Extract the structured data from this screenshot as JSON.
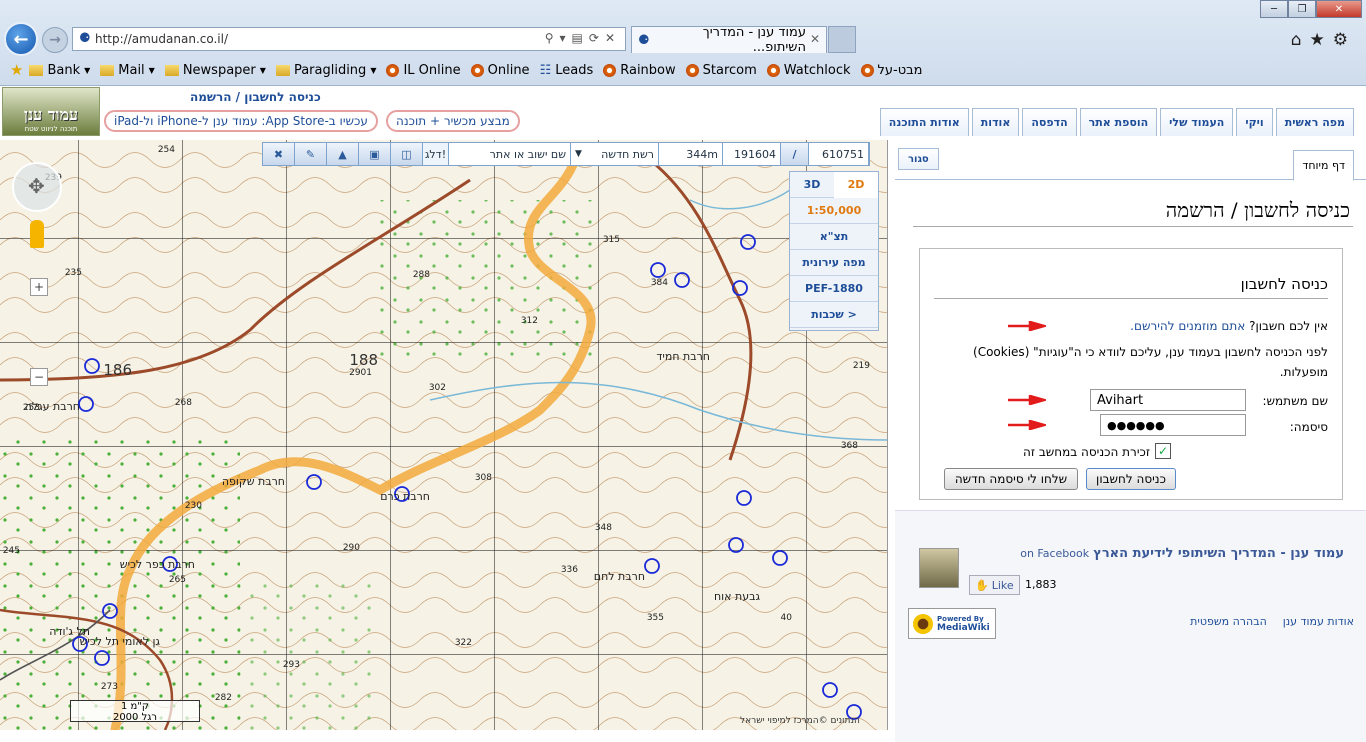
{
  "browser": {
    "url": "http://amudanan.co.il/",
    "tab_title": "עמוד ענן - המדריך השיתופ...",
    "window_controls": [
      "minimize",
      "restore",
      "close"
    ],
    "favorites": [
      {
        "label": "Bank",
        "icon": "folder-icon",
        "dropdown": true
      },
      {
        "label": "Mail",
        "icon": "folder-icon",
        "dropdown": true
      },
      {
        "label": "Newspaper",
        "icon": "folder-icon",
        "dropdown": true
      },
      {
        "label": "Paragliding",
        "icon": "folder-icon",
        "dropdown": true
      },
      {
        "label": "IL Online",
        "icon": "site-icon"
      },
      {
        "label": "Online",
        "icon": "site-icon"
      },
      {
        "label": "Leads",
        "icon": "page-icon"
      },
      {
        "label": "Rainbow",
        "icon": "site-icon"
      },
      {
        "label": "Starcom",
        "icon": "site-icon"
      },
      {
        "label": "Watchlock",
        "icon": "site-icon"
      },
      {
        "label": "מבט-על",
        "icon": "site-icon"
      }
    ]
  },
  "site": {
    "logo": {
      "title": "עמוד ענן",
      "subtitle": "תוכנה לניווט שטח"
    },
    "top_title": "כניסה לחשבון / הרשמה",
    "promo_appstore": "עכשיו ב-App Store: עמוד ענן ל-iPhone ול-iPad",
    "promo_device": "מבצע מכשיר + תוכנה",
    "nav_tabs": [
      "מפה ראשית",
      "ויקי",
      "העמוד שלי",
      "הוספת אתר",
      "הדפסה",
      "אודות",
      "אודות התוכנה"
    ]
  },
  "map_toolbar": {
    "coord_x": "610751",
    "slash": "/",
    "coord_y": "191604",
    "altitude": "344m",
    "grid": "רשת חדשה",
    "search_placeholder": "שם ישוב או אתר",
    "go_label": "דלג!"
  },
  "map_layers": {
    "mode_2d": "2D",
    "mode_3d": "3D",
    "scale": "1:50,000",
    "items": [
      "תצ\"א",
      "מפה עירונית",
      "PEF-1880",
      "שכבות >"
    ]
  },
  "map": {
    "labels": [
      "188",
      "186",
      "חרבת עגלה",
      "חרבת כרם",
      "חרבת שקופה",
      "חרבת חמיד",
      "חרבת לחם",
      "גבעת אוח",
      "גן לאומי תל לכיש",
      "חרבת כפר לכיש",
      "תל ג'ודה",
      "254",
      "239",
      "235",
      "288",
      "312",
      "2901",
      "302",
      "268",
      "253",
      "230",
      "245",
      "290",
      "265",
      "308",
      "348",
      "336",
      "322",
      "355",
      "293",
      "273",
      "282",
      "40",
      "315",
      "384",
      "368",
      "219"
    ],
    "scale_top": "1 ק\"מ",
    "scale_bottom": "2000 רגל",
    "copyright": "הנתונים ©המרכז למיפוי ישראל"
  },
  "panel": {
    "special_tab": "דף מיוחד",
    "close_tab": "סגור",
    "heading": "כניסה לחשבון / הרשמה",
    "login": {
      "title": "כניסה לחשבון",
      "no_account": "אין לכם חשבון?",
      "register_link": "אתם מוזמנים להירשם.",
      "cookies_notice_1": "לפני הכניסה לחשבון בעמוד ענן, עליכם לוודא כי ה\"עוגיות\" (Cookies)",
      "cookies_notice_2": "מופעלות.",
      "username_label": "שם משתמש:",
      "username_value": "Avihart",
      "password_label": "סיסמה:",
      "password_value": "●●●●●●",
      "remember_label": "זכירת הכניסה במחשב זה",
      "remember_checked": true,
      "login_button": "כניסה לחשבון",
      "reset_button": "שלחו לי סיסמה חדשה"
    },
    "facebook": {
      "page_name": "עמוד ענן - המדריך השיתופי לידיעת הארץ",
      "suffix": "on Facebook",
      "like_label": "Like",
      "like_count": "1,883"
    },
    "mediawiki_badge": {
      "line1": "Powered By",
      "line2": "MediaWiki"
    },
    "footer_links": [
      "אודות עמוד ענן",
      "הבהרה משפטית"
    ]
  },
  "colors": {
    "link": "#1f4e99",
    "trail": "#f2a93b",
    "road": "#9c4a2a",
    "arrow": "#e21b1b"
  }
}
